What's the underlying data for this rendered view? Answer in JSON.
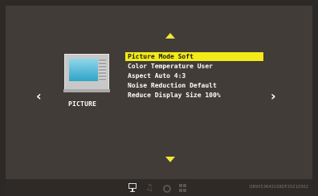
{
  "navigation": {
    "left_glyph": "‹",
    "right_glyph": "›",
    "up_icon": "triangle-up-icon",
    "down_icon": "triangle-down-icon"
  },
  "category": {
    "label": "PICTURE",
    "icon": "tv-icon"
  },
  "menu": {
    "items": [
      {
        "label": "Picture Mode  Soft",
        "active": true
      },
      {
        "label": "Color Temperature User",
        "active": false
      },
      {
        "label": "Aspect Auto 4:3",
        "active": false
      },
      {
        "label": "Noise Reduction Default",
        "active": false
      },
      {
        "label": "Reduce Display Size 100%",
        "active": false
      }
    ]
  },
  "bottom_bar": {
    "sources": [
      {
        "icon": "monitor-icon",
        "active": true
      },
      {
        "icon": "music-note-icon",
        "active": false
      },
      {
        "icon": "disc-icon",
        "active": false
      },
      {
        "icon": "apps-grid-icon",
        "active": false
      }
    ],
    "version": "Q89X53643108DF20210302"
  },
  "colors": {
    "accent": "#f3ea18",
    "background": "#413c38",
    "outer": "#2c2926"
  }
}
